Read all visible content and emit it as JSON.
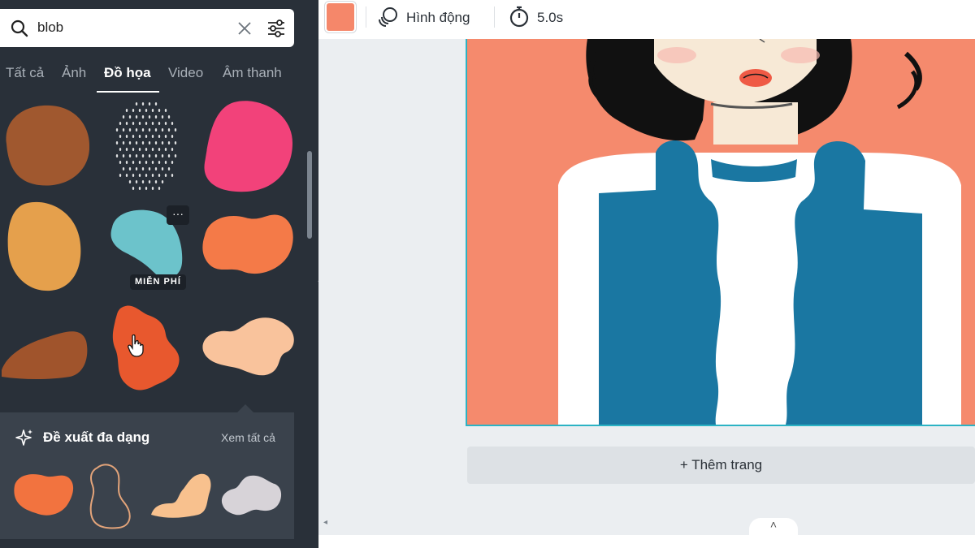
{
  "search": {
    "value": "blob"
  },
  "tabs": [
    {
      "label": "Tất cả",
      "active": false
    },
    {
      "label": "Ảnh",
      "active": false
    },
    {
      "label": "Đồ họa",
      "active": true
    },
    {
      "label": "Video",
      "active": false
    },
    {
      "label": "Âm thanh",
      "active": false
    }
  ],
  "grid": {
    "items": [
      {
        "color": "#a0582f"
      },
      {
        "color": "#ffffff"
      },
      {
        "color": "#f2427a"
      },
      {
        "color": "#e5a04c"
      },
      {
        "color": "#6cc3cb"
      },
      {
        "color": "#f47a48"
      },
      {
        "color": "#a0542c"
      },
      {
        "color": "#e8582e"
      },
      {
        "color": "#f9c39c"
      }
    ],
    "more_label": "···",
    "free_badge": "MIỄN PHÍ"
  },
  "suggestions": {
    "title": "Đề xuất đa dạng",
    "see_all": "Xem tất cả",
    "items": [
      {
        "color": "#f2733f"
      },
      {
        "color": "#e3a47a"
      },
      {
        "color": "#f8c18e"
      },
      {
        "color": "#d7d3d8"
      }
    ]
  },
  "toolbar": {
    "swatch_color": "#f5876a",
    "animate_label": "Hình động",
    "duration_label": "5.0s"
  },
  "canvas": {
    "background_color": "#f58a6d",
    "add_page_label": "+ Thêm trang"
  },
  "colors": {
    "panel_bg": "#293039",
    "accent_border": "#2bb3c4",
    "jacket": "#1a77a2"
  }
}
